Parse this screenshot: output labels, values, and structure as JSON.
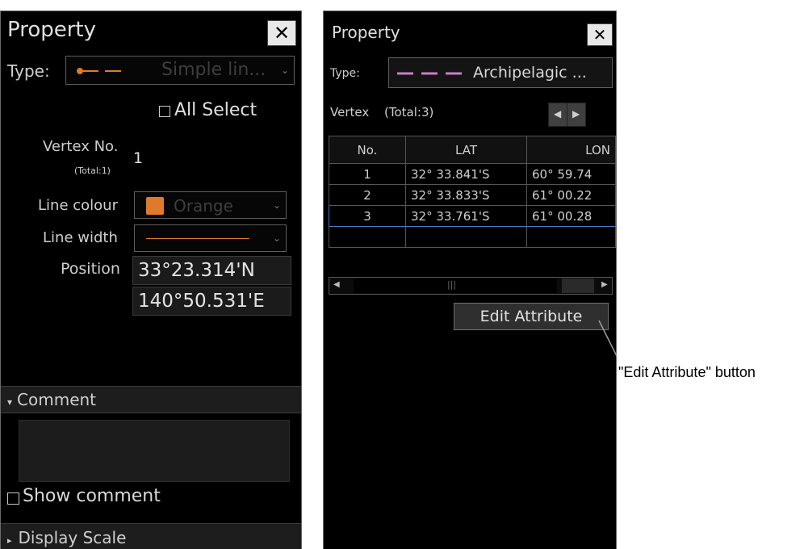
{
  "left_panel": {
    "title": "Property",
    "close_glyph": "✕",
    "type_label": "Type:",
    "type_value": "Simple lin...",
    "all_select_label": "All Select",
    "vertex_no_label": "Vertex No.",
    "vertex_total": "(Total:1)",
    "vertex_no_value": "1",
    "line_colour_label": "Line colour",
    "line_colour_value": "Orange",
    "line_colour_hex": "#e07a2a",
    "line_width_label": "Line width",
    "position_label": "Position",
    "position_lat": "33°23.314'N",
    "position_lon": "140°50.531'E",
    "comment_section": "Comment",
    "show_comment_label": "Show comment",
    "display_scale_section": "Display Scale"
  },
  "right_panel": {
    "title": "Property",
    "close_glyph": "✕",
    "type_label": "Type:",
    "type_value": "Archipelagic ...",
    "line_colour_hex": "#c77fc0",
    "vertex_label": "Vertex",
    "vertex_total": "(Total:3)",
    "table": {
      "columns": [
        "No.",
        "LAT",
        "LON"
      ],
      "rows": [
        {
          "no": "1",
          "lat": "32°  33.841'S",
          "lon": "60°  59.74"
        },
        {
          "no": "2",
          "lat": "32°  33.833'S",
          "lon": "61°  00.22"
        },
        {
          "no": "3",
          "lat": "32°  33.761'S",
          "lon": "61°  00.28"
        }
      ],
      "selected_row": "3"
    },
    "edit_attribute_label": "Edit Attribute"
  },
  "callout": {
    "text": "\"Edit Attribute\" button"
  }
}
